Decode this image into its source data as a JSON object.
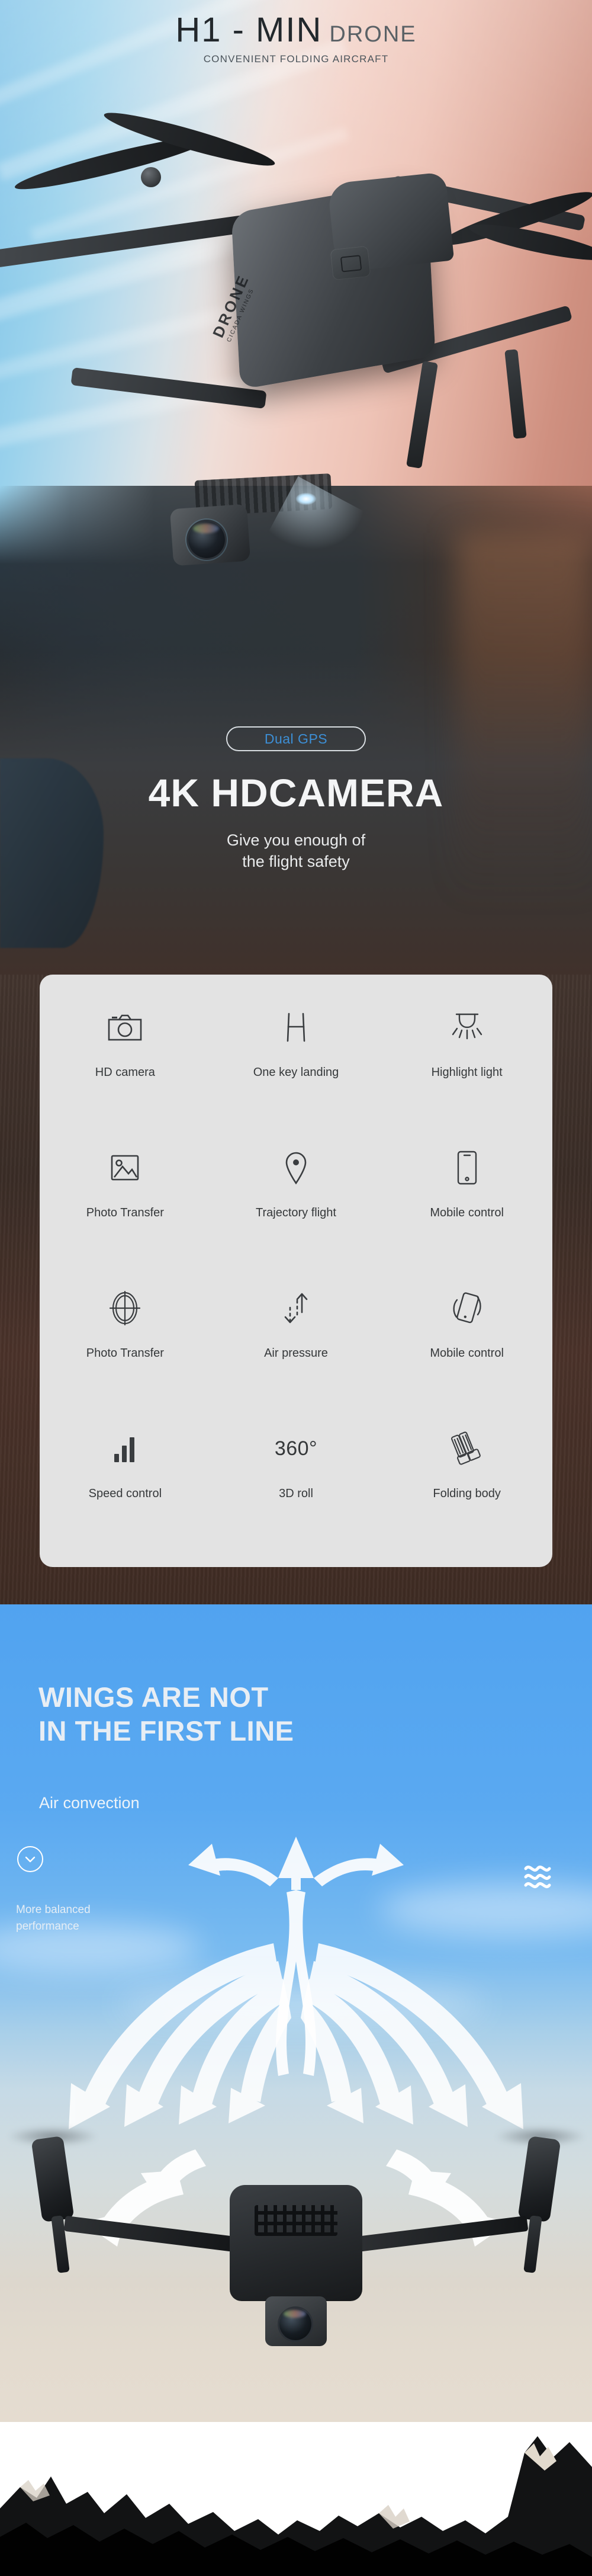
{
  "hero": {
    "title_main": "H1 - MIN",
    "title_sub": "DRONE",
    "tagline": "CONVENIENT FOLDING AIRCRAFT",
    "badge": "Dual GPS",
    "headline": "4K HDCAMERA",
    "subline_1": "Give you enough of",
    "subline_2": "the flight safety",
    "product_mark": "DRONE",
    "product_submark": "CICADA WINGS",
    "badge_text_color": "#3d8fd6",
    "badge_border_color": "#d8dde1"
  },
  "features": {
    "card_bg": "#e3e3e3",
    "items": [
      {
        "icon": "camera-icon",
        "label": "HD camera"
      },
      {
        "icon": "helipad-h-icon",
        "label": "One key landing"
      },
      {
        "icon": "spotlight-icon",
        "label": "Highlight light"
      },
      {
        "icon": "image-icon",
        "label": "Photo Transfer"
      },
      {
        "icon": "map-pin-icon",
        "label": "Trajectory flight"
      },
      {
        "icon": "phone-icon",
        "label": "Mobile control"
      },
      {
        "icon": "crosshair-icon",
        "label": "Photo Transfer"
      },
      {
        "icon": "up-down-arrows-icon",
        "label": "Air pressure"
      },
      {
        "icon": "phone-tilt-icon",
        "label": "Mobile control"
      },
      {
        "icon": "signal-bars-icon",
        "label": "Speed control"
      },
      {
        "icon": "degrees-360-text",
        "label": "3D roll",
        "glyph": "360°"
      },
      {
        "icon": "folded-arms-icon",
        "label": "Folding body"
      }
    ]
  },
  "airflow": {
    "headline_line_1": "WINGS ARE NOT",
    "headline_line_2": "IN THE FIRST LINE",
    "subtitle": "Air convection",
    "note_line_1": "More balanced",
    "note_line_2": "performance",
    "chevron_icon": "chevron-down-icon",
    "wave_icon": "wave-lines-icon",
    "background_color": "#51a3f0"
  }
}
